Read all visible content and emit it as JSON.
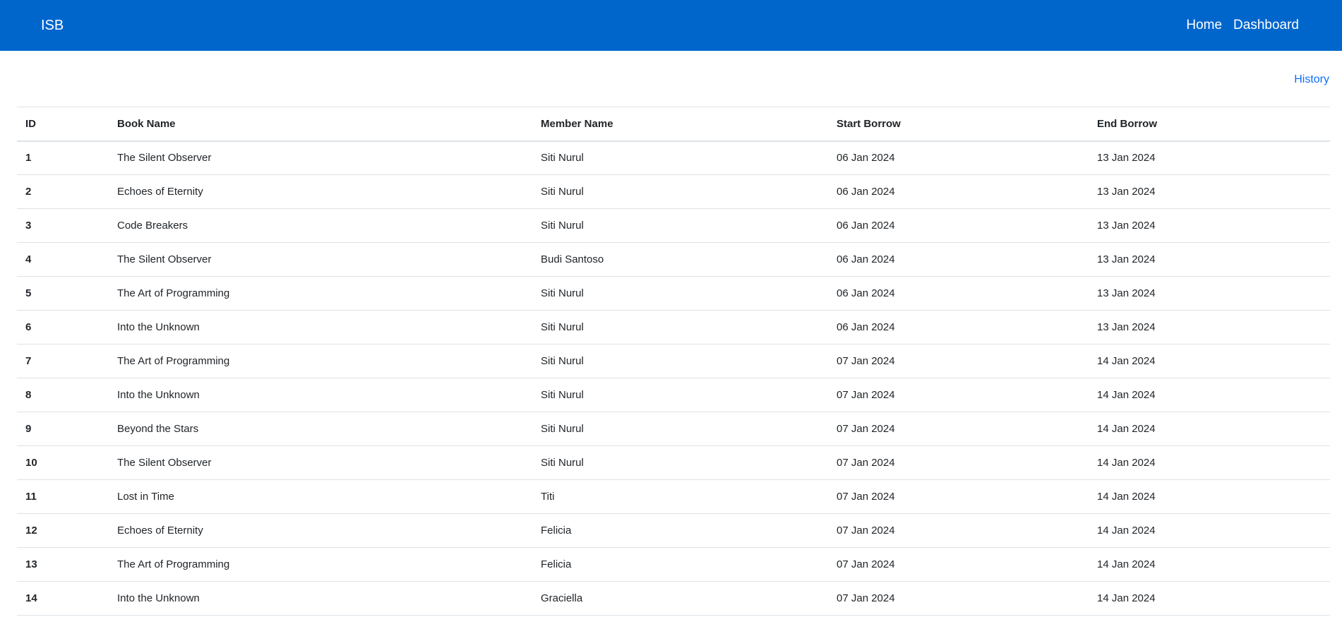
{
  "navbar": {
    "brand": "ISB",
    "links": [
      "Home",
      "Dashboard"
    ]
  },
  "actions": {
    "history_label": "History"
  },
  "table": {
    "headers": [
      "ID",
      "Book Name",
      "Member Name",
      "Start Borrow",
      "End Borrow"
    ],
    "rows": [
      [
        "1",
        "The Silent Observer",
        "Siti Nurul",
        "06 Jan 2024",
        "13 Jan 2024"
      ],
      [
        "2",
        "Echoes of Eternity",
        "Siti Nurul",
        "06 Jan 2024",
        "13 Jan 2024"
      ],
      [
        "3",
        "Code Breakers",
        "Siti Nurul",
        "06 Jan 2024",
        "13 Jan 2024"
      ],
      [
        "4",
        "The Silent Observer",
        "Budi Santoso",
        "06 Jan 2024",
        "13 Jan 2024"
      ],
      [
        "5",
        "The Art of Programming",
        "Siti Nurul",
        "06 Jan 2024",
        "13 Jan 2024"
      ],
      [
        "6",
        "Into the Unknown",
        "Siti Nurul",
        "06 Jan 2024",
        "13 Jan 2024"
      ],
      [
        "7",
        "The Art of Programming",
        "Siti Nurul",
        "07 Jan 2024",
        "14 Jan 2024"
      ],
      [
        "8",
        "Into the Unknown",
        "Siti Nurul",
        "07 Jan 2024",
        "14 Jan 2024"
      ],
      [
        "9",
        "Beyond the Stars",
        "Siti Nurul",
        "07 Jan 2024",
        "14 Jan 2024"
      ],
      [
        "10",
        "The Silent Observer",
        "Siti Nurul",
        "07 Jan 2024",
        "14 Jan 2024"
      ],
      [
        "11",
        "Lost in Time",
        "Titi",
        "07 Jan 2024",
        "14 Jan 2024"
      ],
      [
        "12",
        "Echoes of Eternity",
        "Felicia",
        "07 Jan 2024",
        "14 Jan 2024"
      ],
      [
        "13",
        "The Art of Programming",
        "Felicia",
        "07 Jan 2024",
        "14 Jan 2024"
      ],
      [
        "14",
        "Into the Unknown",
        "Graciella",
        "07 Jan 2024",
        "14 Jan 2024"
      ]
    ]
  },
  "colors": {
    "navbar_bg": "#0066cc",
    "link": "#0d6efd",
    "border": "#dee2e6"
  }
}
